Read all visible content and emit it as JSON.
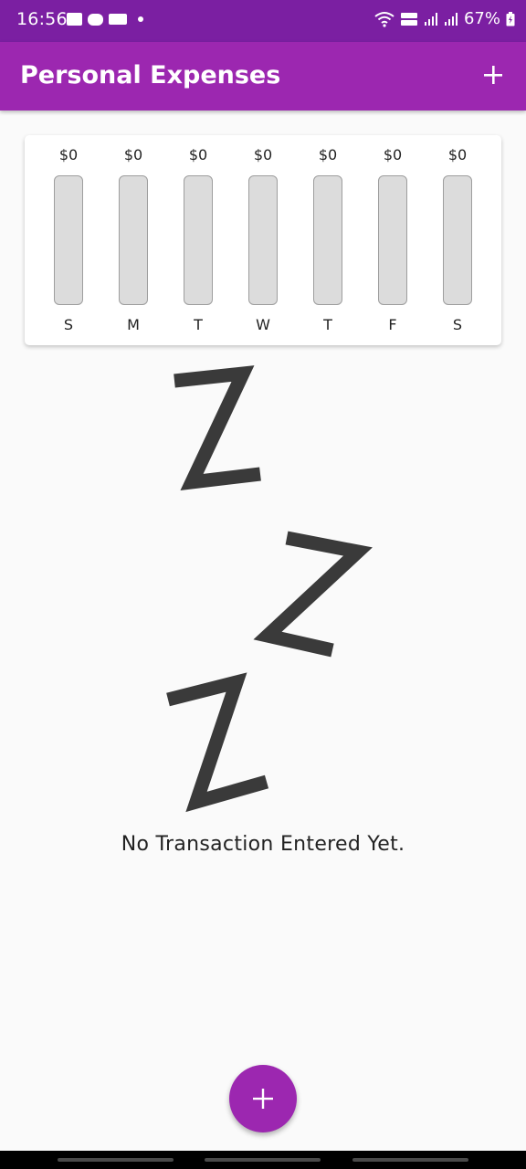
{
  "status_bar": {
    "time": "16:56",
    "battery": "67%"
  },
  "app_bar": {
    "title": "Personal Expenses",
    "add_icon": "plus-icon"
  },
  "chart_data": {
    "type": "bar",
    "categories": [
      "S",
      "M",
      "T",
      "W",
      "T",
      "F",
      "S"
    ],
    "values": [
      0,
      0,
      0,
      0,
      0,
      0,
      0
    ],
    "data_labels": [
      "$0",
      "$0",
      "$0",
      "$0",
      "$0",
      "$0",
      "$0"
    ],
    "fill_fraction": [
      0,
      0,
      0,
      0,
      0,
      0,
      0
    ],
    "title": "",
    "xlabel": "",
    "ylabel": "",
    "grid": false
  },
  "empty_state": {
    "image": "sleeping-zzz-icon",
    "message": "No Transaction Entered Yet."
  },
  "fab": {
    "icon": "plus-icon"
  },
  "colors": {
    "primary": "#9c27b0",
    "primary_dark": "#7b1fa2",
    "bar_track": "#dcdcdc",
    "zzz": "#3a3a3a"
  }
}
